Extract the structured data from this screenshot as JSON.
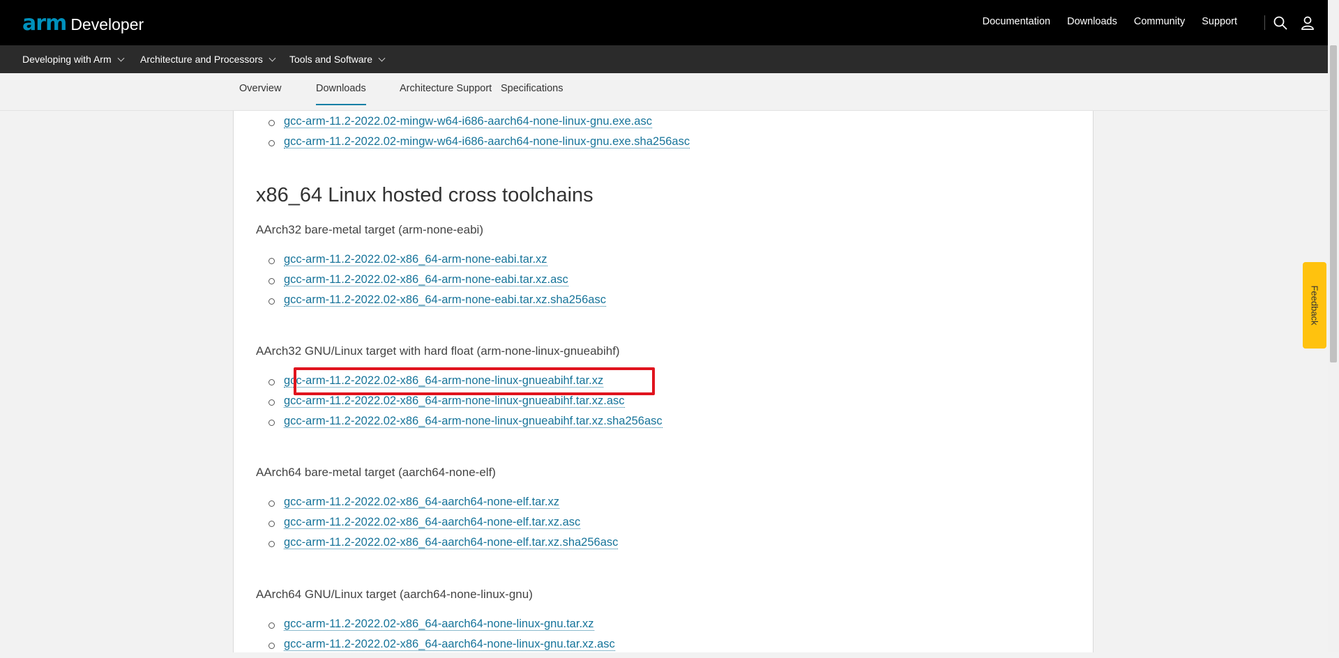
{
  "header": {
    "logo_arm": "arm",
    "logo_developer": "Developer",
    "nav": [
      "Documentation",
      "Downloads",
      "Community",
      "Support"
    ],
    "search_icon": "search-icon",
    "user_icon": "user-icon"
  },
  "secondary_nav": {
    "items": [
      "Developing with Arm",
      "Architecture and Processors",
      "Tools and Software"
    ]
  },
  "tabs": {
    "items": [
      "Overview",
      "Downloads",
      "Architecture Support",
      "Specifications"
    ],
    "active": "Downloads"
  },
  "content": {
    "top_links": [
      "gcc-arm-11.2-2022.02-mingw-w64-i686-aarch64-none-linux-gnu.exe.asc",
      "gcc-arm-11.2-2022.02-mingw-w64-i686-aarch64-none-linux-gnu.exe.sha256asc"
    ],
    "section_title": "x86_64 Linux hosted cross toolchains",
    "groups": [
      {
        "title": "AArch32 bare-metal target (arm-none-eabi)",
        "links": [
          "gcc-arm-11.2-2022.02-x86_64-arm-none-eabi.tar.xz",
          "gcc-arm-11.2-2022.02-x86_64-arm-none-eabi.tar.xz.asc",
          "gcc-arm-11.2-2022.02-x86_64-arm-none-eabi.tar.xz.sha256asc"
        ]
      },
      {
        "title": "AArch32 GNU/Linux target with hard float (arm-none-linux-gnueabihf)",
        "links": [
          "gcc-arm-11.2-2022.02-x86_64-arm-none-linux-gnueabihf.tar.xz",
          "gcc-arm-11.2-2022.02-x86_64-arm-none-linux-gnueabihf.tar.xz.asc",
          "gcc-arm-11.2-2022.02-x86_64-arm-none-linux-gnueabihf.tar.xz.sha256asc"
        ]
      },
      {
        "title": "AArch64 bare-metal target (aarch64-none-elf)",
        "links": [
          "gcc-arm-11.2-2022.02-x86_64-aarch64-none-elf.tar.xz",
          "gcc-arm-11.2-2022.02-x86_64-aarch64-none-elf.tar.xz.asc",
          "gcc-arm-11.2-2022.02-x86_64-aarch64-none-elf.tar.xz.sha256asc"
        ]
      },
      {
        "title": "AArch64 GNU/Linux target (aarch64-none-linux-gnu)",
        "links": [
          "gcc-arm-11.2-2022.02-x86_64-aarch64-none-linux-gnu.tar.xz",
          "gcc-arm-11.2-2022.02-x86_64-aarch64-none-linux-gnu.tar.xz.asc"
        ]
      }
    ]
  },
  "feedback": {
    "label": "Feedback"
  },
  "colors": {
    "link": "#17749a",
    "accent": "#0091bd",
    "highlight": "#e0141e",
    "feedback": "#ffc20e"
  }
}
